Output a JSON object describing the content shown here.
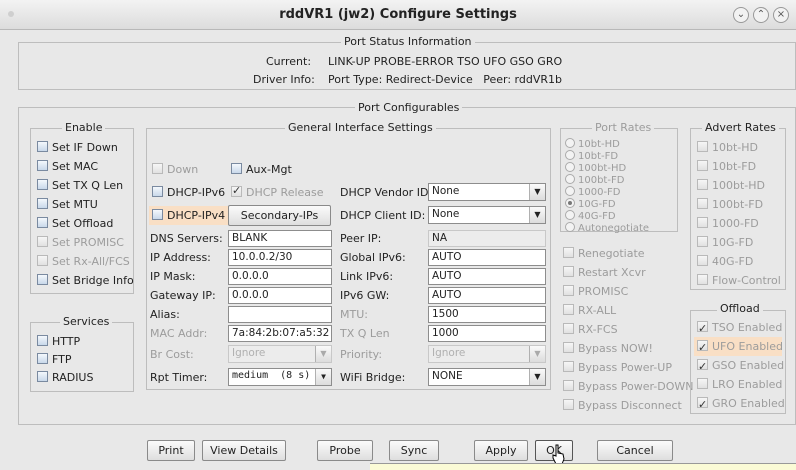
{
  "window": {
    "title": "rddVR1  (jw2) Configure Settings"
  },
  "status": {
    "section_title": "Port Status Information",
    "current_label": "Current:",
    "current_value": "LINK-UP PROBE-ERROR TSO UFO GSO GRO",
    "driver_label": "Driver Info:",
    "driver_value": "Port Type: Redirect-Device   Peer: rddVR1b"
  },
  "configurables": {
    "section_title": "Port Configurables"
  },
  "enable": {
    "title": "Enable",
    "items": [
      {
        "label": "Set IF Down",
        "checked": false,
        "disabled": false
      },
      {
        "label": "Set MAC",
        "checked": false,
        "disabled": false
      },
      {
        "label": "Set TX Q Len",
        "checked": false,
        "disabled": false
      },
      {
        "label": "Set MTU",
        "checked": false,
        "disabled": false
      },
      {
        "label": "Set Offload",
        "checked": false,
        "disabled": false
      },
      {
        "label": "Set PROMISC",
        "checked": false,
        "disabled": true
      },
      {
        "label": "Set Rx-All/FCS",
        "checked": false,
        "disabled": true
      },
      {
        "label": "Set Bridge Info",
        "checked": false,
        "disabled": false
      }
    ]
  },
  "services": {
    "title": "Services",
    "items": [
      {
        "label": "HTTP"
      },
      {
        "label": "FTP"
      },
      {
        "label": "RADIUS"
      }
    ]
  },
  "general": {
    "title": "General Interface Settings",
    "down_label": "Down",
    "aux_mgt_label": "Aux-Mgt",
    "dhcp_ipv6_label": "DHCP-IPv6",
    "dhcp_release_label": "DHCP Release",
    "dhcp_vendor_label": "DHCP Vendor ID:",
    "dhcp_vendor_value": "None",
    "dhcp_ipv4_label": "DHCP-IPv4",
    "secondary_ips_label": "Secondary-IPs",
    "dhcp_client_label": "DHCP Client ID:",
    "dhcp_client_value": "None",
    "dns_label": "DNS Servers:",
    "dns_value": "BLANK",
    "peer_ip_label": "Peer IP:",
    "peer_ip_value": "NA",
    "ip_label": "IP Address:",
    "ip_value": "10.0.0.2/30",
    "global_ipv6_label": "Global IPv6:",
    "global_ipv6_value": "AUTO",
    "mask_label": "IP Mask:",
    "mask_value": "0.0.0.0",
    "link_ipv6_label": "Link IPv6:",
    "link_ipv6_value": "AUTO",
    "gateway_label": "Gateway IP:",
    "gateway_value": "0.0.0.0",
    "ipv6_gw_label": "IPv6 GW:",
    "ipv6_gw_value": "AUTO",
    "alias_label": "Alias:",
    "alias_value": "",
    "mtu_label": "MTU:",
    "mtu_value": "1500",
    "mac_label": "MAC Addr:",
    "mac_value": "7a:84:2b:07:a5:32",
    "txq_label": "TX Q Len",
    "txq_value": "1000",
    "brcost_label": "Br Cost:",
    "brcost_value": "Ignore",
    "priority_label": "Priority:",
    "priority_value": "Ignore",
    "rpt_label": "Rpt Timer:",
    "rpt_value": "medium  (8 s)",
    "wifi_bridge_label": "WiFi Bridge:",
    "wifi_bridge_value": "NONE"
  },
  "port_rates": {
    "title": "Port Rates",
    "items": [
      "10bt-HD",
      "10bt-FD",
      "100bt-HD",
      "100bt-FD",
      "1000-FD",
      "10G-FD",
      "40G-FD",
      "Autonegotiate"
    ],
    "selected": "10G-FD"
  },
  "misc": {
    "items": [
      "Renegotiate",
      "Restart Xcvr",
      "PROMISC",
      "RX-ALL",
      "RX-FCS",
      "Bypass NOW!",
      "Bypass Power-UP",
      "Bypass Power-DOWN",
      "Bypass Disconnect"
    ]
  },
  "advert_rates": {
    "title": "Advert Rates",
    "items": [
      "10bt-HD",
      "10bt-FD",
      "100bt-HD",
      "100bt-FD",
      "1000-FD",
      "10G-FD",
      "40G-FD",
      "Flow-Control"
    ]
  },
  "offload": {
    "title": "Offload",
    "items": [
      {
        "label": "TSO Enabled",
        "checked": true
      },
      {
        "label": "UFO Enabled",
        "checked": true
      },
      {
        "label": "GSO Enabled",
        "checked": true
      },
      {
        "label": "LRO Enabled",
        "checked": false
      },
      {
        "label": "GRO Enabled",
        "checked": true
      }
    ]
  },
  "buttons": {
    "print": "Print",
    "view_details": "View Details",
    "probe": "Probe",
    "sync": "Sync",
    "apply": "Apply",
    "ok": "OK",
    "cancel": "Cancel"
  }
}
